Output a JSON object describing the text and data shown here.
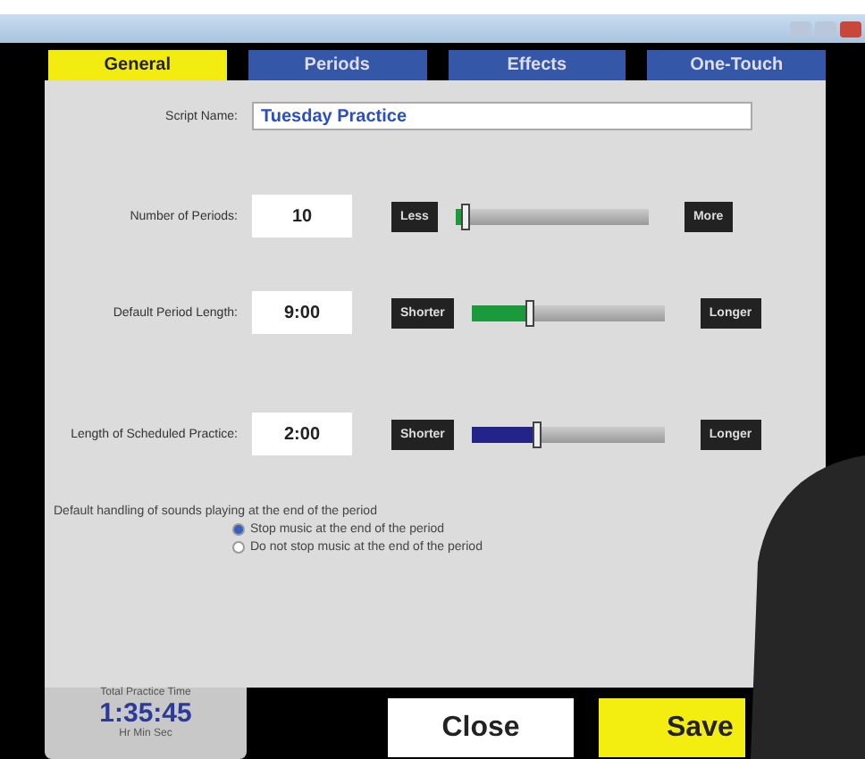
{
  "tabs": [
    {
      "label": "General",
      "selected": true
    },
    {
      "label": "Periods",
      "selected": false
    },
    {
      "label": "Effects",
      "selected": false
    },
    {
      "label": "One-Touch",
      "selected": false
    }
  ],
  "script_name": {
    "label": "Script Name:",
    "value": "Tuesday Practice"
  },
  "settings": [
    {
      "label": "Number of Periods:",
      "value": "10",
      "less": "Less",
      "more": "More",
      "level": 0.05,
      "color": "#1a9a3a"
    },
    {
      "label": "Default Period Length:",
      "value": "9:00",
      "less": "Shorter",
      "more": "Longer",
      "level": 0.3,
      "color": "#1a9a3a"
    },
    {
      "label": "Length of Scheduled Practice:",
      "value": "2:00",
      "less": "Shorter",
      "more": "Longer",
      "level": 0.33,
      "color": "#23238a"
    }
  ],
  "sound_handling": {
    "label": "Default handling of sounds playing at the end of the period",
    "options": [
      {
        "label": "Stop music at the end of the period",
        "selected": true
      },
      {
        "label": "Do not stop music at the end of the period",
        "selected": false
      }
    ]
  },
  "total_time": {
    "label": "Total Practice Time",
    "value": "1:35:45",
    "unit": "Hr Min Sec"
  },
  "buttons": {
    "close": "Close",
    "save": "Save"
  }
}
